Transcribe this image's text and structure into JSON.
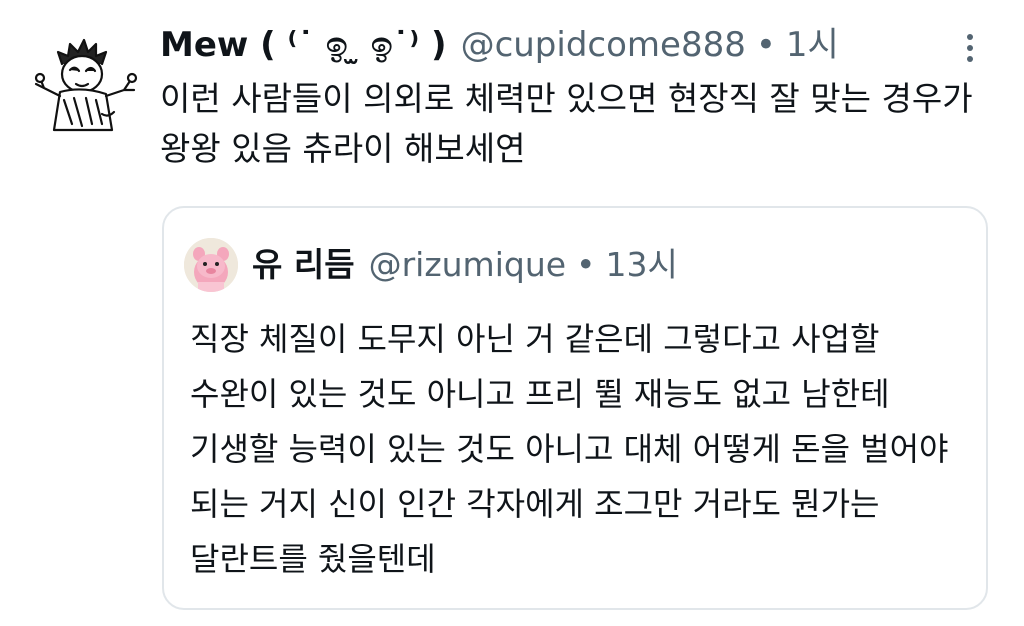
{
  "tweet": {
    "display_name": "Mew ( ⁽˙ ඉ ̫ ඉ˙⁾ )",
    "handle": "@cupidcome888",
    "separator": "•",
    "time": "1시",
    "avatar_icon": "cartoon-person-avatar-icon",
    "more_icon": "more-options-vertical-dots-icon",
    "text_lines": [
      "이런 사람들이 의외로 체력만 있으면 현장직 잘 맞는 경우가",
      "왕왕 있음 츄라이 해보세연"
    ]
  },
  "quote": {
    "display_name": "유 리듬",
    "handle": "@rizumique",
    "separator": "•",
    "time": "13시",
    "avatar_icon": "pink-character-avatar-icon",
    "text_lines": [
      "직장 체질이 도무지 아닌 거 같은데 그렇다고 사업할",
      "수완이 있는 것도 아니고 프리 뛸 재능도 없고 남한테",
      "기생할 능력이 있는 것도 아니고 대체 어떻게 돈을 벌어야",
      "되는 거지 신이 인간 각자에게 조그만 거라도 뭔가는",
      "달란트를 줬을텐데"
    ]
  },
  "colors": {
    "text": "#0f1419",
    "secondary": "#536471",
    "border": "#e1e6ea",
    "background": "#ffffff"
  }
}
